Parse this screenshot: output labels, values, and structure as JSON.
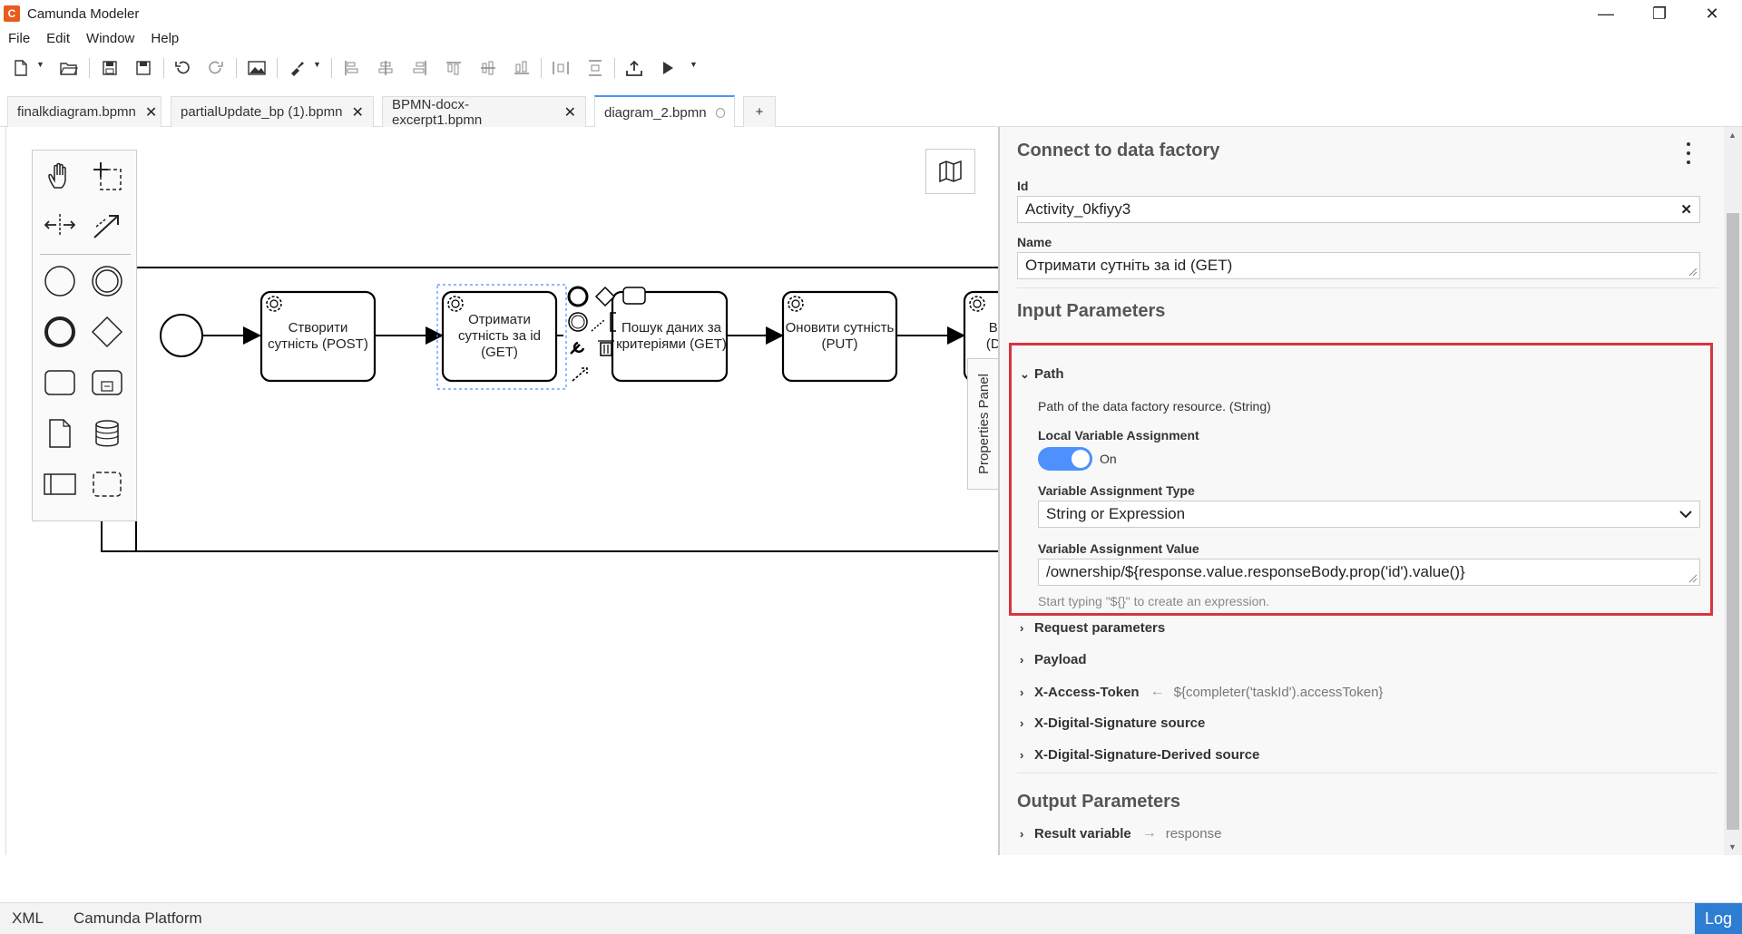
{
  "window": {
    "title": "Camunda Modeler",
    "minimize_glyph": "—",
    "restore_glyph": "❐",
    "close_glyph": "✕"
  },
  "menu": [
    "File",
    "Edit",
    "Window",
    "Help"
  ],
  "tabs": [
    {
      "label": "finalkdiagram.bpmn",
      "active": false
    },
    {
      "label": "partialUpdate_bp (1).bpmn",
      "active": false
    },
    {
      "label": "BPMN-docx-excerpt1.bpmn",
      "active": false
    },
    {
      "label": "diagram_2.bpmn",
      "active": true
    }
  ],
  "add_tab_label": "+",
  "diagram": {
    "tasks": [
      "Створити сутність (POST)",
      "Отримати сутність за id (GET)",
      "Пошук даних за критеріями (GET)",
      "Оновити сутність (PUT)",
      "В... (D..."
    ]
  },
  "props_toggle_label": "Properties Panel",
  "properties": {
    "title": "Connect to data factory",
    "id_label": "Id",
    "id_value": "Activity_0kfiyy3",
    "name_label": "Name",
    "name_value": "Отримати сутніть за id (GET)",
    "input_params_title": "Input Parameters",
    "path_group": "Path",
    "path_description": "Path of the data factory resource. (String)",
    "local_var_label": "Local Variable Assignment",
    "toggle_state": "On",
    "var_type_label": "Variable Assignment Type",
    "var_type_value": "String or Expression",
    "var_value_label": "Variable Assignment Value",
    "var_value": "/ownership/${response.value.responseBody.prop('id').value()}",
    "expression_hint": "Start typing \"${}\" to create an expression.",
    "groups": [
      {
        "label": "Request parameters",
        "sub": ""
      },
      {
        "label": "Payload",
        "sub": ""
      },
      {
        "label": "X-Access-Token",
        "sub": "${completer('taskId').accessToken}"
      },
      {
        "label": "X-Digital-Signature source",
        "sub": ""
      },
      {
        "label": "X-Digital-Signature-Derived source",
        "sub": ""
      }
    ],
    "output_params_title": "Output Parameters",
    "result_label": "Result variable",
    "result_value": "response"
  },
  "status": {
    "xml": "XML",
    "platform": "Camunda Platform",
    "log": "Log"
  },
  "colors": {
    "accent": "#4d90fe",
    "highlight": "#d9343f",
    "log_bg": "#2d7dd2",
    "app_icon": "#e85c1d"
  }
}
